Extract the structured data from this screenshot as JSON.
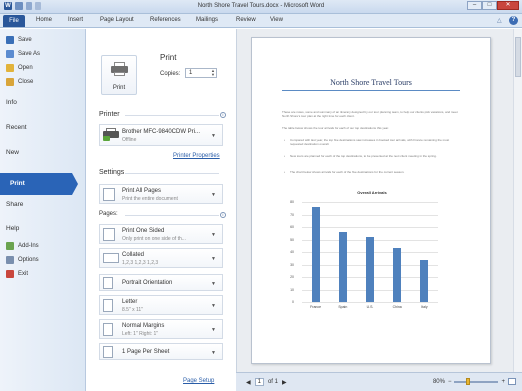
{
  "app": {
    "title": "North Shore Travel Tours.docx - Microsoft Word",
    "qat_word_letter": "W",
    "window_buttons": [
      "–",
      "□",
      "✕"
    ]
  },
  "ribbon": {
    "file_tab": "File",
    "tabs": [
      "Home",
      "Insert",
      "Page Layout",
      "References",
      "Mailings",
      "Review",
      "View"
    ],
    "minimize_glyph": "△",
    "help_glyph": "?"
  },
  "backstage": {
    "commands": [
      {
        "label": "Save",
        "icon": "save-icon",
        "color": "#3a6fb7"
      },
      {
        "label": "Save As",
        "icon": "save-as-icon",
        "color": "#5b8bd0"
      },
      {
        "label": "Open",
        "icon": "open-folder-icon",
        "color": "#e2b33b"
      },
      {
        "label": "Close",
        "icon": "close-folder-icon",
        "color": "#d9a53a"
      }
    ],
    "sections": [
      "Info",
      "Recent",
      "New",
      "Print",
      "Share",
      "Help"
    ],
    "bottom_commands": [
      {
        "label": "Add-Ins",
        "icon": "add-ins-icon",
        "color": "#6aa34f"
      },
      {
        "label": "Options",
        "icon": "options-icon",
        "color": "#7a8fae"
      },
      {
        "label": "Exit",
        "icon": "exit-icon",
        "color": "#c9463d"
      }
    ]
  },
  "print_panel": {
    "heading": "Print",
    "button_label": "Print",
    "copies_label": "Copies:",
    "copies_value": "1",
    "printer_heading": "Printer",
    "printer_name": "Brother MFC-9840CDW Pri...",
    "printer_status": "Offline",
    "printer_properties_link": "Printer Properties",
    "settings_heading": "Settings",
    "settings": [
      {
        "line1": "Print All Pages",
        "line2": "Print the entire document"
      },
      {
        "line1": "Print One Sided",
        "line2": "Only print on one side of th..."
      },
      {
        "line1": "Collated",
        "line2": "1,2,3   1,2,3   1,2,3"
      },
      {
        "line1": "Portrait Orientation",
        "line2": ""
      },
      {
        "line1": "Letter",
        "line2": "8.5\" x 11\""
      },
      {
        "line1": "Normal Margins",
        "line2": "Left: 1\"    Right: 1\""
      },
      {
        "line1": "1 Page Per Sheet",
        "line2": ""
      }
    ],
    "pages_label": "Pages:",
    "page_setup_link": "Page Setup",
    "info_glyph": "i"
  },
  "preview": {
    "doc_title": "North Shore Travel Tours",
    "paragraphs": [
      "These are notes, some and summary of an itinerary designed by our tour planning team, to help our clients pick vacations, and meet North Shore's tour plan at the right time for each client.",
      "The table below shows the tour arrivals for each of our top destinations this year."
    ],
    "bullets": [
      "Compared with last year, the top five destinations saw increases in booked tour arrivals, with France remaining the most requested destination overall.",
      "New tours are planned for each of the top destinations, to be presented at the next client meeting in the spring.",
      "The chart below shows arrivals for each of the five destinations for the current season."
    ],
    "page_current": "1",
    "page_total": "of 1",
    "prev_glyph": "◀",
    "next_glyph": "▶"
  },
  "chart_data": {
    "type": "bar",
    "title": "Overall Arrivals",
    "categories": [
      "France",
      "Spain",
      "U.S.",
      "China",
      "Italy"
    ],
    "values": [
      76,
      56,
      52,
      43,
      34
    ],
    "ylim": [
      0,
      80
    ],
    "yticks": [
      0,
      10,
      20,
      30,
      40,
      50,
      60,
      70,
      80
    ],
    "xlabel": "",
    "ylabel": "",
    "color": "#4f81bd",
    "grid": true
  },
  "status": {
    "zoom": "80%",
    "zoom_out": "−",
    "zoom_in": "+",
    "zoom_level": 0.3
  }
}
